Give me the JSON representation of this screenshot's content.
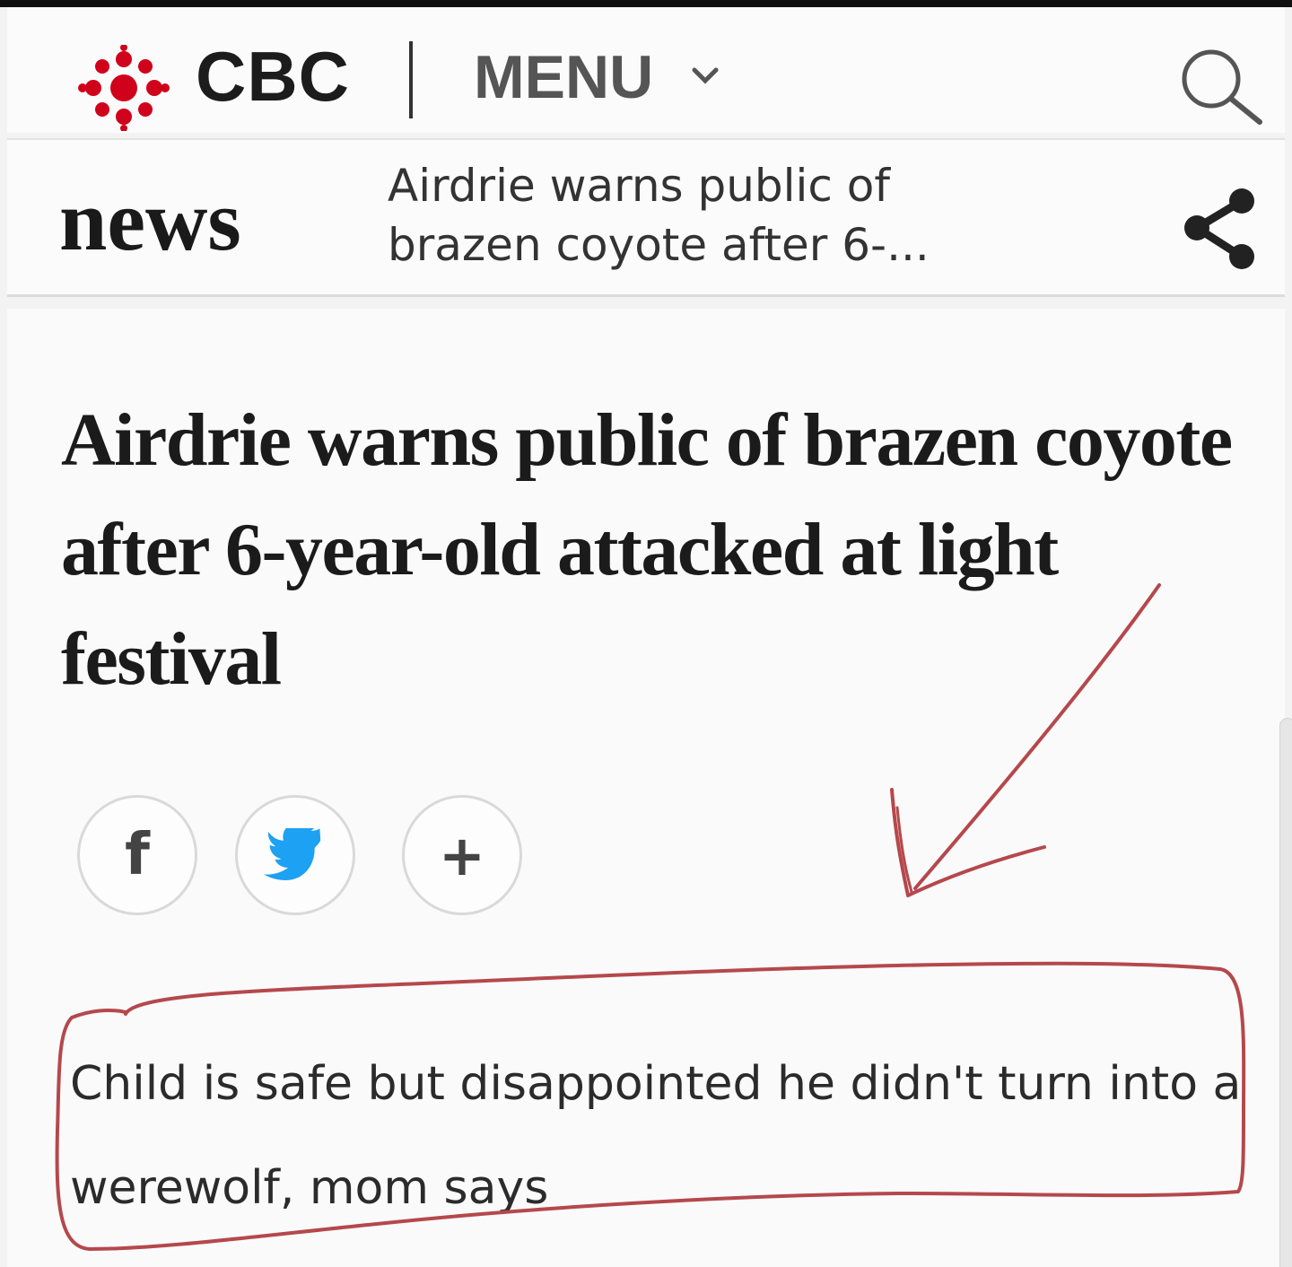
{
  "header": {
    "brand": "CBC",
    "menu_label": "MENU",
    "icons": {
      "logo": "cbc-gem-logo",
      "menu_chevron": "chevron-down-icon",
      "search": "search-icon",
      "share": "share-icon"
    }
  },
  "subheader": {
    "section": "news",
    "title_truncated": "Airdrie warns public of brazen coyote after 6-..."
  },
  "article": {
    "headline": "Airdrie warns public of brazen coyote after 6-year-old attacked at light festival",
    "social_buttons": [
      {
        "label": "f",
        "icon": "facebook-icon"
      },
      {
        "icon": "twitter-icon"
      },
      {
        "label": "+",
        "icon": "plus-icon"
      }
    ],
    "subheadline": "Child is safe but disappointed he didn't turn into a werewolf, mom says"
  },
  "colors": {
    "brand_red": "#d0021b",
    "annotation_red": "#b5484c",
    "text_dark": "#1b1b1b",
    "background": "#f3f3f3"
  }
}
